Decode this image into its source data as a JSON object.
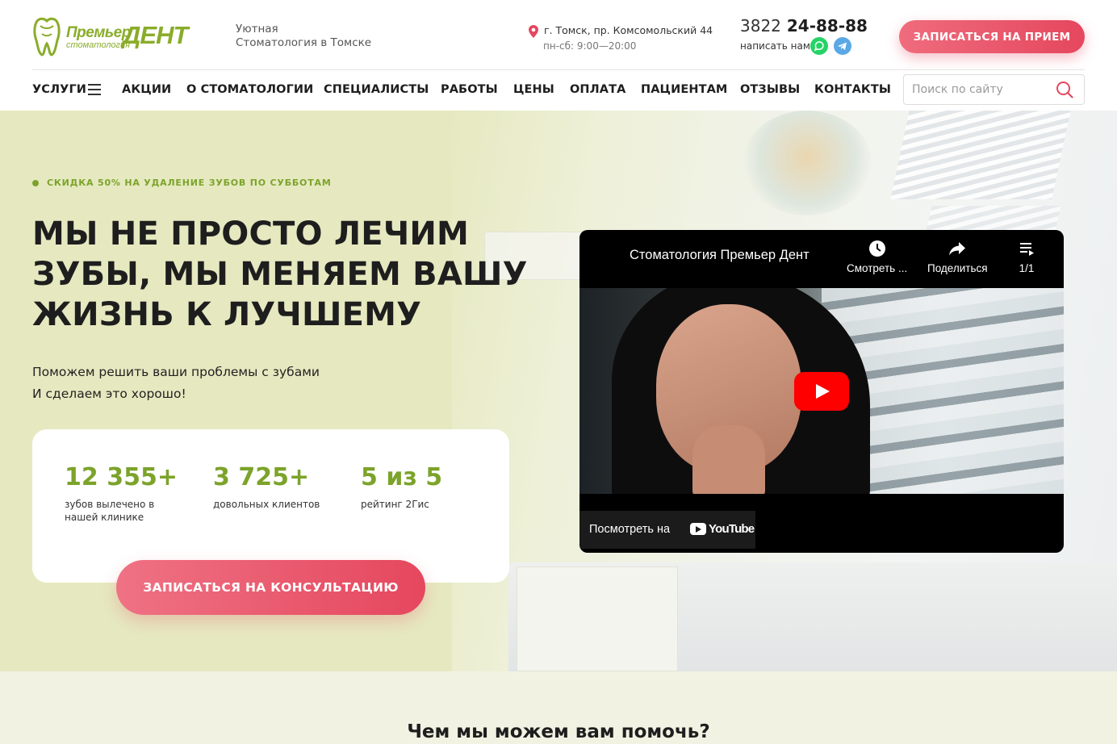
{
  "header": {
    "logo": {
      "brand_top": "Премьер",
      "brand_main": "ДЕНТ",
      "brand_sub": "стоматология"
    },
    "tagline": {
      "line1": "Уютная",
      "line2": "Стоматология в Томске"
    },
    "address": "г. Томск, пр. Комсомольский 44",
    "hours": "пн-сб: 9:00—20:00",
    "phone": {
      "code": "3822",
      "number": "24-88-88"
    },
    "write_us": "написать нам",
    "cta_label": "ЗАПИСАТЬСЯ НА ПРИЕМ"
  },
  "nav": {
    "items": [
      {
        "label": "УСЛУГИ"
      },
      {
        "label": "АКЦИИ"
      },
      {
        "label": "О СТОМАТОЛОГИИ"
      },
      {
        "label": "СПЕЦИАЛИСТЫ"
      },
      {
        "label": "РАБОТЫ"
      },
      {
        "label": "ЦЕНЫ"
      },
      {
        "label": "ОПЛАТА"
      },
      {
        "label": "ПАЦИЕНТАМ"
      },
      {
        "label": "ОТЗЫВЫ"
      },
      {
        "label": "КОНТАКТЫ"
      }
    ],
    "search_placeholder": "Поиск по сайту"
  },
  "hero": {
    "promo": "СКИДКА 50% НА УДАЛЕНИЕ ЗУБОВ ПО СУББОТАМ",
    "title": "МЫ НЕ ПРОСТО ЛЕЧИМ ЗУБЫ, МЫ МЕНЯЕМ ВАШУ ЖИЗНЬ К ЛУЧШЕМУ",
    "subtitle_line1": "Поможем решить ваши проблемы с зубами",
    "subtitle_line2": "И сделаем это хорошо!",
    "stats": [
      {
        "value": "12 355+",
        "label": "зубов вылечено в нашей клинике"
      },
      {
        "value": "3 725+",
        "label": "довольных клиентов"
      },
      {
        "value": "5 из 5",
        "label": "рейтинг 2Гис"
      }
    ],
    "cta_label": "ЗАПИСАТЬСЯ НА КОНСУЛЬТАЦИЮ"
  },
  "video": {
    "title": "Стоматология Премьер Дент",
    "watch_later": "Смотреть ...",
    "share": "Поделиться",
    "playlist": "1/1",
    "watch_on": "Посмотреть на",
    "youtube": "YouTube"
  },
  "section2": {
    "title": "Чем мы можем вам помочь?"
  },
  "colors": {
    "accent_green": "#7ca32a",
    "accent_pink": "#e5475e",
    "hero_bg": "#e8ebc4"
  }
}
